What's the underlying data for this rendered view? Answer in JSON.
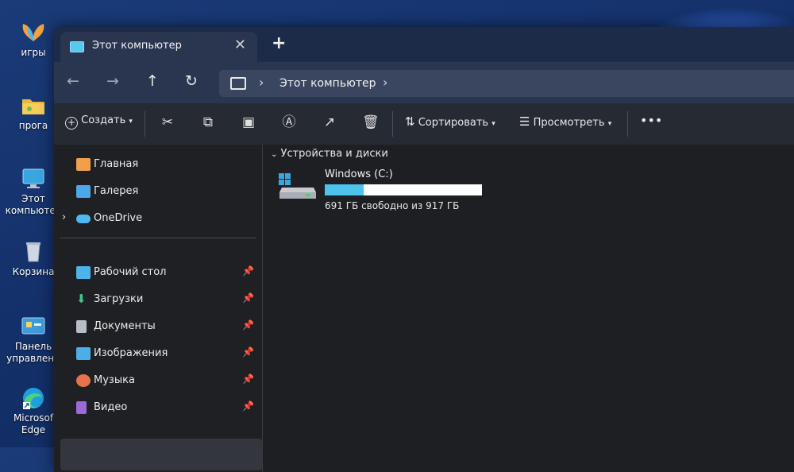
{
  "desktop": {
    "icons": [
      {
        "label": "игры"
      },
      {
        "label": "прога"
      },
      {
        "label_line1": "Этот",
        "label_line2": "компьютер"
      },
      {
        "label": "Корзина"
      },
      {
        "label_line1": "Панель",
        "label_line2": "управлени"
      },
      {
        "label_line1": "Microsof",
        "label_line2": "Edge"
      }
    ]
  },
  "window": {
    "tab": {
      "title": "Этот компьютер",
      "close_icon": "close-icon"
    },
    "new_tab_icon": "plus-icon",
    "nav": {
      "back_icon": "arrow-left-icon",
      "forward_icon": "arrow-right-icon",
      "up_icon": "arrow-up-icon",
      "refresh_icon": "refresh-icon"
    },
    "address": {
      "crumb": "Этот компьютер"
    },
    "toolbar": {
      "create_label": "Создать",
      "sort_label": "Сортировать",
      "view_label": "Просмотреть",
      "icons": [
        "cut-icon",
        "copy-icon",
        "paste-icon",
        "rename-icon",
        "share-icon",
        "delete-icon",
        "more-icon"
      ]
    },
    "sidebar": {
      "top": [
        {
          "label": "Главная",
          "icon": "home-icon",
          "color": "#f0a04a"
        },
        {
          "label": "Галерея",
          "icon": "gallery-icon",
          "color": "#4ca8e8"
        },
        {
          "label": "OneDrive",
          "icon": "cloud-icon",
          "color": "#4fb8f0"
        }
      ],
      "pinned": [
        {
          "label": "Рабочий стол",
          "icon": "desktop-icon",
          "color": "#4cb4ea"
        },
        {
          "label": "Загрузки",
          "icon": "download-icon",
          "color": "#4cc08c"
        },
        {
          "label": "Документы",
          "icon": "document-icon",
          "color": "#b8bcc6"
        },
        {
          "label": "Изображения",
          "icon": "image-icon",
          "color": "#4caee8"
        },
        {
          "label": "Музыка",
          "icon": "music-icon",
          "color": "#e8734a"
        },
        {
          "label": "Видео",
          "icon": "video-icon",
          "color": "#9a6ad8"
        }
      ]
    },
    "main": {
      "group_header": "Устройства и диски",
      "drive": {
        "name": "Windows (C:)",
        "free_text": "691 ГБ свободно из 917 ГБ",
        "used_fraction": 0.246,
        "bar_color": "#4cc2ec"
      }
    }
  }
}
